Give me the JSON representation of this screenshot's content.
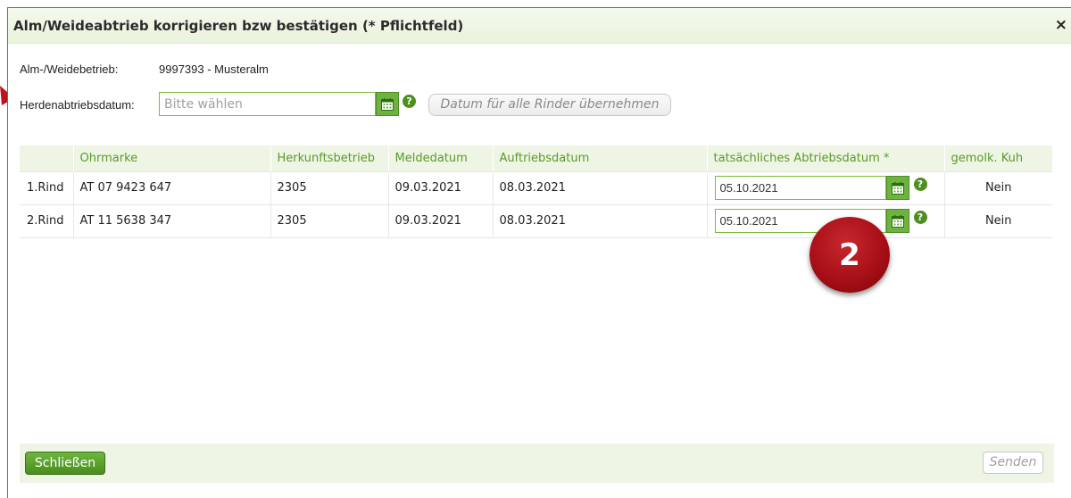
{
  "dialog": {
    "title": "Alm/Weideabtrieb korrigieren bzw bestätigen (* Pflichtfeld)",
    "close_symbol": "×"
  },
  "form": {
    "betrieb_label": "Alm-/Weidebetrieb:",
    "betrieb_value": "9997393 - Musteralm",
    "herde_label": "Herdenabtriebsdatum:",
    "herde_placeholder": "Bitte wählen",
    "herde_value": "",
    "uebernehmen_label": "Datum für alle Rinder übernehmen"
  },
  "table": {
    "headers": [
      "",
      "Ohrmarke",
      "Herkunftsbetrieb",
      "Meldedatum",
      "Auftriebsdatum",
      "tatsächliches Abtriebsdatum *",
      "gemolk. Kuh"
    ],
    "rows": [
      {
        "label": "1.Rind",
        "ohrmarke": "AT 07 9423 647",
        "herkunft": "2305",
        "melde": "09.03.2021",
        "auftrieb": "08.03.2021",
        "abtrieb": "05.10.2021",
        "gemolk": "Nein"
      },
      {
        "label": "2.Rind",
        "ohrmarke": "AT 11 5638 347",
        "herkunft": "2305",
        "melde": "09.03.2021",
        "auftrieb": "08.03.2021",
        "abtrieb": "05.10.2021",
        "gemolk": "Nein"
      }
    ]
  },
  "help_symbol": "?",
  "icons": {
    "calendar": "calendar-icon",
    "help": "help-icon",
    "close": "close-icon",
    "arrow": "arrow-icon"
  },
  "annotation": {
    "badge_number": "2"
  },
  "footer": {
    "close_label": "Schließen",
    "send_label": "Senden"
  },
  "colors": {
    "accent": "#6cb33f",
    "header_bg": "#eef5e4",
    "badge": "#a80f17",
    "arrow": "#c0141c"
  }
}
